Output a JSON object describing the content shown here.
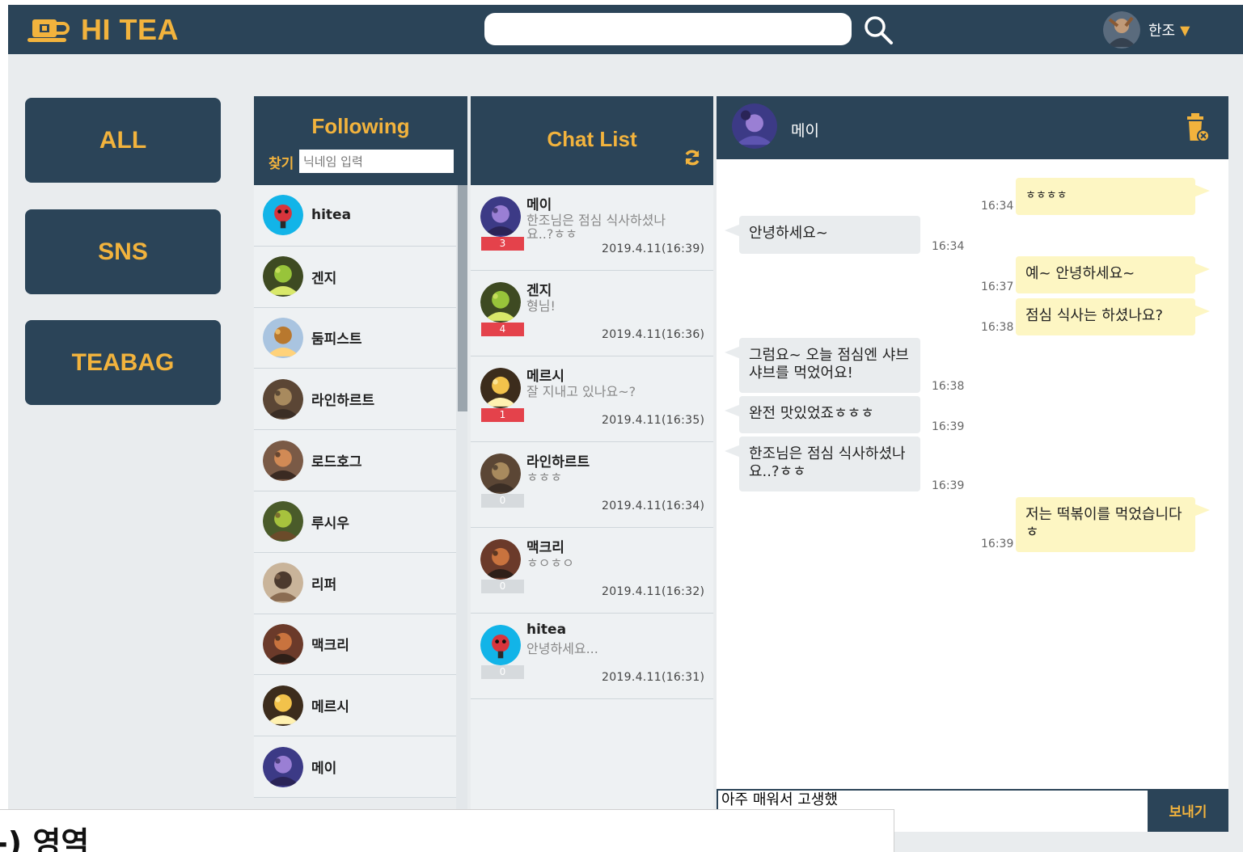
{
  "header": {
    "logo_text": "HI TEA",
    "search": {
      "value": "",
      "placeholder": ""
    },
    "user": {
      "name": "한조",
      "caret": "▼"
    }
  },
  "menu": [
    {
      "label": "ALL"
    },
    {
      "label": "SNS"
    },
    {
      "label": "TEABAG"
    }
  ],
  "following": {
    "title": "Following",
    "find_label": "찾기",
    "find_placeholder": "닉네임 입력",
    "items": [
      {
        "name": "hitea",
        "avatar": "hitea"
      },
      {
        "name": "겐지",
        "avatar": "genji"
      },
      {
        "name": "둠피스트",
        "avatar": "doomfist"
      },
      {
        "name": "라인하르트",
        "avatar": "reinhardt"
      },
      {
        "name": "로드호그",
        "avatar": "roadhog"
      },
      {
        "name": "루시우",
        "avatar": "lucio"
      },
      {
        "name": "리퍼",
        "avatar": "reaper"
      },
      {
        "name": "맥크리",
        "avatar": "mccree"
      },
      {
        "name": "메르시",
        "avatar": "mercy"
      },
      {
        "name": "메이",
        "avatar": "mei"
      }
    ]
  },
  "chat_list": {
    "title": "Chat List",
    "items": [
      {
        "name": "메이",
        "preview": "한조님은 점심 식사하셨나요..?ㅎㅎ",
        "unread": "3",
        "time": "2019.4.11(16:39)",
        "avatar": "mei"
      },
      {
        "name": "겐지",
        "preview": "형님!",
        "unread": "4",
        "time": "2019.4.11(16:36)",
        "avatar": "genji"
      },
      {
        "name": "메르시",
        "preview": "잘 지내고 있나요~?",
        "unread": "1",
        "time": "2019.4.11(16:35)",
        "avatar": "mercy"
      },
      {
        "name": "라인하르트",
        "preview": "ㅎㅎㅎ",
        "unread": "0",
        "time": "2019.4.11(16:34)",
        "avatar": "reinhardt"
      },
      {
        "name": "맥크리",
        "preview": "ㅎㅇㅎㅇ",
        "unread": "0",
        "time": "2019.4.11(16:32)",
        "avatar": "mccree"
      },
      {
        "name": "hitea",
        "preview": "안녕하세요...",
        "unread": "0",
        "time": "2019.4.11(16:31)",
        "avatar": "hitea"
      }
    ]
  },
  "chat_room": {
    "partner": "메이",
    "messages": [
      {
        "from": "me",
        "text": "ㅎㅎㅎㅎ",
        "time": "16:34"
      },
      {
        "from": "other",
        "text": "안녕하세요~",
        "time": "16:34"
      },
      {
        "from": "me",
        "text": "예~ 안녕하세요~",
        "time": "16:37"
      },
      {
        "from": "me",
        "text": "점심 식사는 하셨나요?",
        "time": "16:38"
      },
      {
        "from": "other",
        "text": "그럼요~ 오늘 점심엔 샤브샤브를 먹었어요!",
        "time": "16:38"
      },
      {
        "from": "other",
        "text": "완전 맛있었죠ㅎㅎㅎ",
        "time": "16:39"
      },
      {
        "from": "other",
        "text": "한조님은 점심 식사하셨나요..?ㅎㅎ",
        "time": "16:39"
      },
      {
        "from": "me",
        "text": "저는 떡볶이를 먹었습니다ㅎ",
        "time": "16:39"
      }
    ],
    "compose_value": "아주 매워서 고생했",
    "send_label": "보내기"
  },
  "overlay": {
    "text": "-) 영역"
  },
  "colors": {
    "navy": "#2b4458",
    "accent": "#f2b33d",
    "badge_red": "#e4424b",
    "bubble_me": "#fdf6c3",
    "bubble_other": "#e9ecee"
  }
}
